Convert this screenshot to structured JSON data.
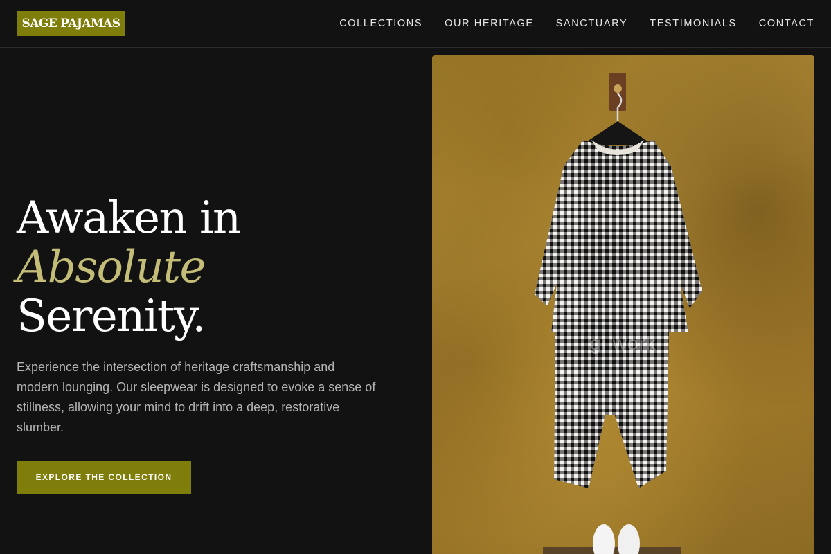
{
  "brand": {
    "name": "SAGE PAJAMAS"
  },
  "nav": {
    "items": [
      {
        "label": "COLLECTIONS"
      },
      {
        "label": "OUR HERITAGE"
      },
      {
        "label": "SANCTUARY"
      },
      {
        "label": "TESTIMONIALS"
      },
      {
        "label": "CONTACT"
      }
    ]
  },
  "hero": {
    "title_line1": "Awaken in",
    "title_accent": "Absolute",
    "title_line3": "Serenity.",
    "description": "Experience the intersection of heritage craftsmanship and modern lounging. Our sleepwear is designed to evoke a sense of stillness, allowing your mind to drift into a deep, restorative slumber.",
    "cta_label": "EXPLORE THE COLLECTION",
    "image_watermark": "gi work"
  },
  "colors": {
    "accent": "#7f7e0b",
    "accent_text": "#c3bd78",
    "background": "#121212"
  }
}
